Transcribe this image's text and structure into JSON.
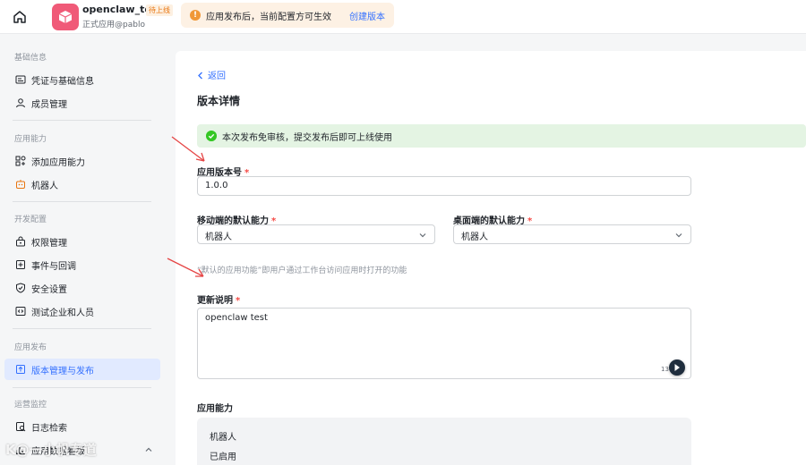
{
  "header": {
    "app_name": "openclaw_test",
    "app_badge": "待上线",
    "app_subtitle": "正式应用@pablo",
    "notice_text": "应用发布后，当前配置方可生效",
    "notice_link": "创建版本"
  },
  "sidebar": {
    "sections": [
      {
        "title": "基础信息",
        "items": [
          {
            "label": "凭证与基础信息",
            "icon": "credential-icon"
          },
          {
            "label": "成员管理",
            "icon": "user-icon"
          }
        ]
      },
      {
        "title": "应用能力",
        "items": [
          {
            "label": "添加应用能力",
            "icon": "apps-grid-icon"
          },
          {
            "label": "机器人",
            "icon": "robot-icon"
          }
        ]
      },
      {
        "title": "开发配置",
        "items": [
          {
            "label": "权限管理",
            "icon": "lock-icon"
          },
          {
            "label": "事件与回调",
            "icon": "event-icon"
          },
          {
            "label": "安全设置",
            "icon": "shield-icon"
          },
          {
            "label": "测试企业和人员",
            "icon": "code-icon"
          }
        ]
      },
      {
        "title": "应用发布",
        "items": [
          {
            "label": "版本管理与发布",
            "icon": "publish-icon",
            "active": true
          }
        ]
      },
      {
        "title": "运营监控",
        "items": [
          {
            "label": "日志检索",
            "icon": "log-search-icon"
          },
          {
            "label": "应用数据看板",
            "icon": "chart-icon"
          }
        ]
      }
    ]
  },
  "main": {
    "back_label": "返回",
    "title": "版本详情",
    "success_text": "本次发布免审核，提交发布后即可上线使用",
    "version_label": "应用版本号",
    "version_value": "1.0.0",
    "mobile_label": "移动端的默认能力",
    "mobile_value": "机器人",
    "desktop_label": "桌面端的默认能力",
    "desktop_value": "机器人",
    "hint": "“默认的应用功能”即用户通过工作台访问应用时打开的功能",
    "notes_label": "更新说明",
    "notes_value": "openclaw test",
    "counter_value": "13",
    "capability_label": "应用能力",
    "capability_name": "机器人",
    "capability_status": "已启用",
    "required_mark": "*"
  },
  "overlay": {
    "watermark": "K@一小帆专道"
  },
  "colors": {
    "accent": "#3370ff",
    "warning": "#f09838",
    "success": "#34c724",
    "required": "#f54a45",
    "annotation_arrow": "#e54545"
  }
}
